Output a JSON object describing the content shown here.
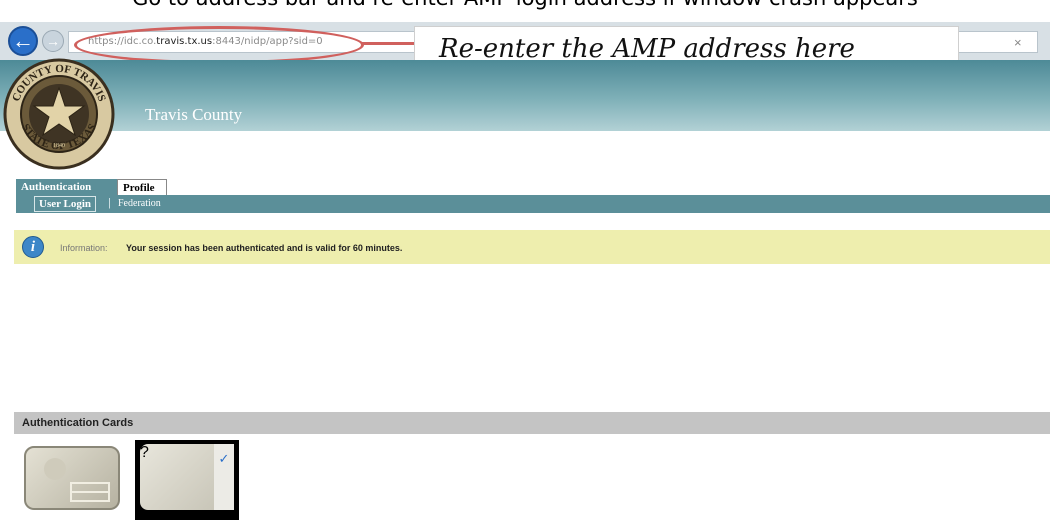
{
  "caption": "Go to address bar and re-enter AMP login address if window crash appears",
  "browser": {
    "back_icon": "back-arrow-icon",
    "forward_icon": "forward-arrow-icon",
    "url_prefix": "https://idc.co.",
    "url_host": "travis.tx.us",
    "url_suffix": ":8443/nidp/app?sid=0",
    "close_glyph": "×"
  },
  "callout": {
    "text": "Re-enter the AMP address here",
    "color": "#d0605d"
  },
  "header": {
    "title": "Travis County",
    "seal_top_text": "COUNTY OF TRAVIS",
    "seal_bottom_text": "STATE OF TEXAS",
    "seal_year": "1840"
  },
  "tabs": [
    {
      "label": "Authentication",
      "active": true
    },
    {
      "label": "Profile",
      "active": false
    }
  ],
  "subnav": [
    {
      "label": "User Login",
      "active": true
    },
    {
      "label": "Federation",
      "active": false
    }
  ],
  "info": {
    "icon": "info-icon",
    "label": "Information:",
    "message": "Your session has been authenticated and is valid for 60 minutes."
  },
  "cards": {
    "header": "Authentication Cards",
    "items": [
      {
        "icon": "id-card-icon",
        "selected": false
      },
      {
        "icon": "question-card-icon",
        "glyph": "?",
        "check": "✓",
        "selected": true
      }
    ]
  },
  "colors": {
    "banner_top": "#4d8a97",
    "nav": "#5b8f99",
    "info_bg": "#eeeeae",
    "cards_header_bg": "#c4c4c4"
  }
}
